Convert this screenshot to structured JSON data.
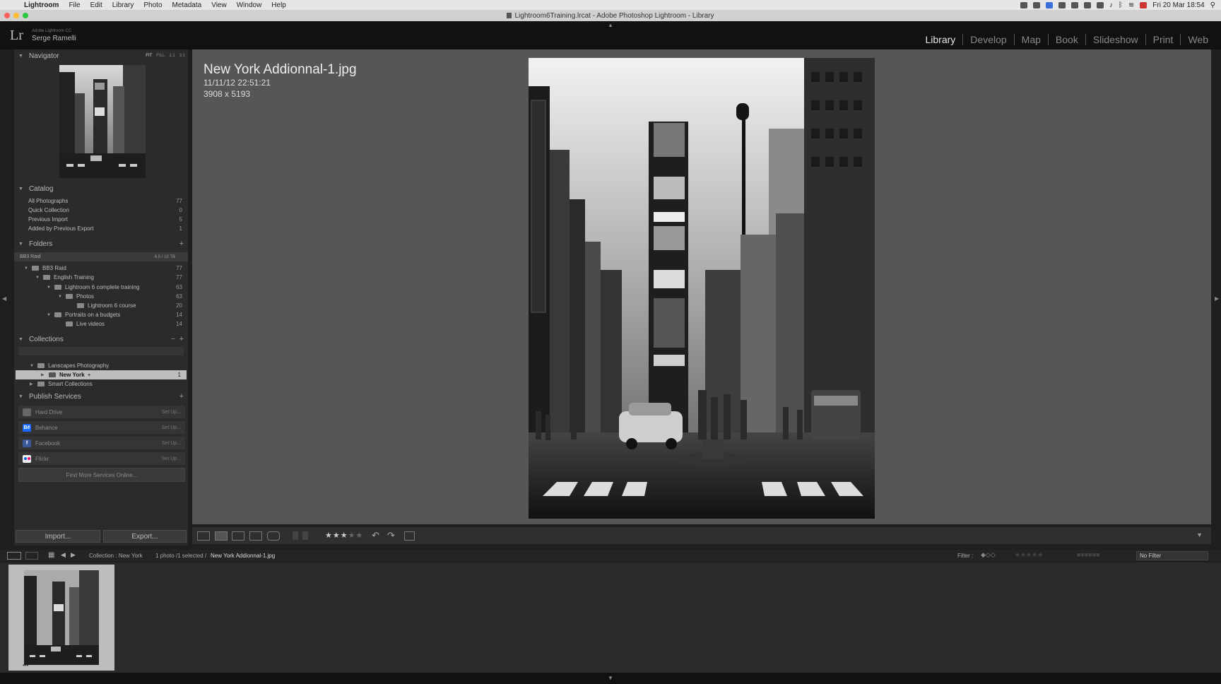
{
  "menubar": {
    "app": "Lightroom",
    "items": [
      "File",
      "Edit",
      "Library",
      "Photo",
      "Metadata",
      "View",
      "Window",
      "Help"
    ],
    "clock": "Fri 20 Mar  18:54"
  },
  "window": {
    "title": "Lightroom6Training.lrcat - Adobe Photoshop Lightroom - Library"
  },
  "identity": {
    "logo": "Lr",
    "top_line": "Adobe Lightroom CC",
    "name": "Serge Ramelli"
  },
  "modules": [
    "Library",
    "Develop",
    "Map",
    "Book",
    "Slideshow",
    "Print",
    "Web"
  ],
  "navigator": {
    "title": "Navigator",
    "zoom_options": [
      "FIT",
      "FILL",
      "1:1",
      "3:1"
    ]
  },
  "catalog": {
    "title": "Catalog",
    "items": [
      {
        "label": "All Photographs",
        "count": "77"
      },
      {
        "label": "Quick Collection",
        "count": "0"
      },
      {
        "label": "Previous Import",
        "count": "5"
      },
      {
        "label": "Added by Previous Export",
        "count": "1"
      }
    ]
  },
  "folders": {
    "title": "Folders",
    "volume": {
      "label": "BB3 Raid",
      "space": "6.5 / 10 TB"
    },
    "items": [
      {
        "label": "BB3 Raid",
        "count": "77"
      },
      {
        "label": "English Training",
        "count": "77"
      },
      {
        "label": "Lightroom 6 complete training",
        "count": "63"
      },
      {
        "label": "Photos",
        "count": "63"
      },
      {
        "label": "Lightroom 6 course",
        "count": "20"
      },
      {
        "label": "Portraits on a budgets",
        "count": "14"
      },
      {
        "label": "Live videos",
        "count": "14"
      }
    ]
  },
  "collections": {
    "title": "Collections",
    "items": [
      {
        "label": "Lanscapes Photography",
        "count": ""
      },
      {
        "label": "New York",
        "count": "1",
        "mark": "+"
      },
      {
        "label": "Smart Collections",
        "count": ""
      }
    ]
  },
  "publish": {
    "title": "Publish Services",
    "items": [
      {
        "label": "Hard Drive",
        "action": "Set Up..."
      },
      {
        "label": "Behance",
        "action": "Set Up..."
      },
      {
        "label": "Facebook",
        "action": "Set Up..."
      },
      {
        "label": "Flickr",
        "action": "Set Up..."
      }
    ],
    "find_more": "Find More Services Online..."
  },
  "buttons": {
    "import": "Import...",
    "export": "Export..."
  },
  "photo_info": {
    "filename": "New York Addionnal-1.jpg",
    "datetime": "11/11/12 22:51:21",
    "dimensions": "3908 x 5193"
  },
  "toolbar": {
    "rating": 3,
    "max_rating": 5
  },
  "filmstrip": {
    "source": "Collection : New York",
    "selection": "1 photo /1 selected /",
    "filename": "New York Addionnal-1.jpg",
    "filter_label": "Filter :",
    "filter_value": "No Filter"
  },
  "colors": {
    "accent": "#e8e8e8",
    "panel": "#2b2b2b",
    "main_bg": "#565656",
    "selected_row": "#bdbdbd",
    "behance": "#1769ff",
    "facebook": "#3b5998",
    "flickr_pink": "#ff0084",
    "flickr_blue": "#0063dc"
  }
}
